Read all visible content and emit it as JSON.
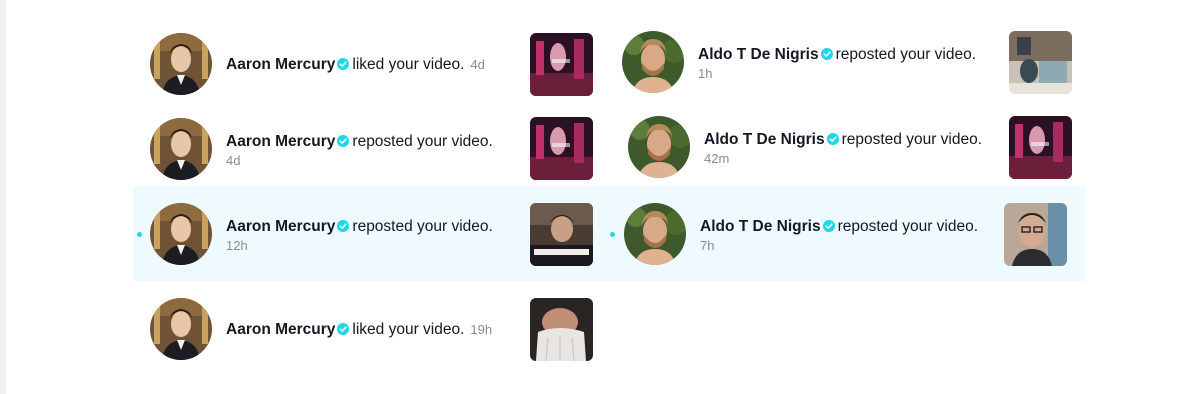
{
  "colors": {
    "accent": "#20d5ec",
    "highlight": "#eefaff"
  },
  "verified_icon": "verified-badge-icon",
  "left_column": [
    {
      "name": "Aaron Mercury",
      "action": "liked your video.",
      "time": "4d"
    },
    {
      "name": "Aaron Mercury",
      "action": "reposted your video.",
      "time": "4d"
    },
    {
      "name": "Aaron Mercury",
      "action": "reposted your video.",
      "time": "12h"
    },
    {
      "name": "Aaron Mercury",
      "action": "liked your video.",
      "time": "19h"
    }
  ],
  "right_column": [
    {
      "name": "Aldo T De Nigris",
      "action": "reposted your video.",
      "time": "1h"
    },
    {
      "name": "Aldo T De Nigris",
      "action": "reposted your video.",
      "time": "42m"
    },
    {
      "name": "Aldo T De Nigris",
      "action": "reposted your video.",
      "time": "7h"
    }
  ]
}
